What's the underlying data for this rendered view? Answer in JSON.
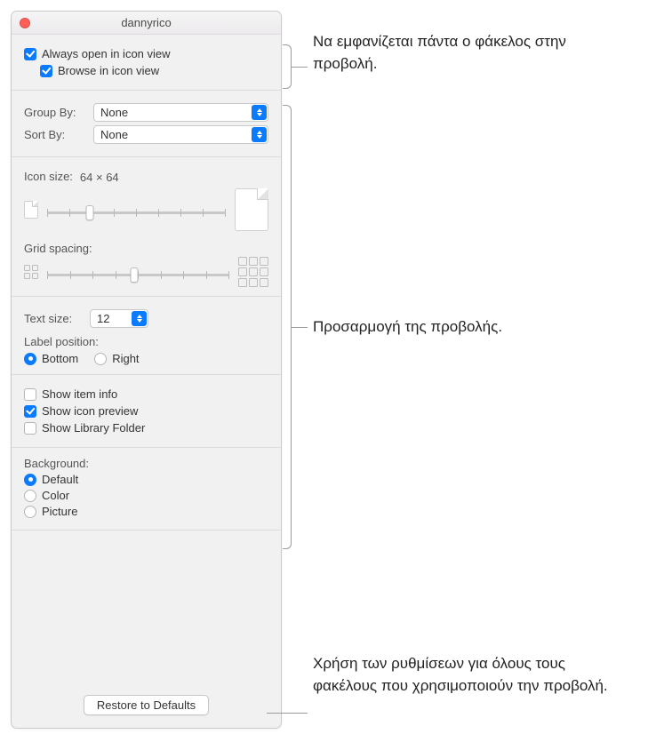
{
  "window": {
    "title": "dannyrico"
  },
  "viewMode": {
    "alwaysOpen": "Always open in icon view",
    "browse": "Browse in icon view"
  },
  "grouping": {
    "groupByLabel": "Group By:",
    "groupByValue": "None",
    "sortByLabel": "Sort By:",
    "sortByValue": "None"
  },
  "iconSize": {
    "label": "Icon size:",
    "value": "64 × 64"
  },
  "gridSpacing": {
    "label": "Grid spacing:"
  },
  "textSize": {
    "label": "Text size:",
    "value": "12"
  },
  "labelPosition": {
    "label": "Label position:",
    "bottom": "Bottom",
    "right": "Right"
  },
  "showOptions": {
    "itemInfo": "Show item info",
    "iconPreview": "Show icon preview",
    "libraryFolder": "Show Library Folder"
  },
  "background": {
    "label": "Background:",
    "default": "Default",
    "color": "Color",
    "picture": "Picture"
  },
  "footer": {
    "restore": "Restore to Defaults"
  },
  "callouts": {
    "c1": "Να εμφανίζεται πάντα ο φάκελος στην προβολή.",
    "c2": "Προσαρμογή της προβολής.",
    "c3": "Χρήση των ρυθμίσεων για όλους τους φακέλους που χρησιμοποιούν την προβολή."
  }
}
